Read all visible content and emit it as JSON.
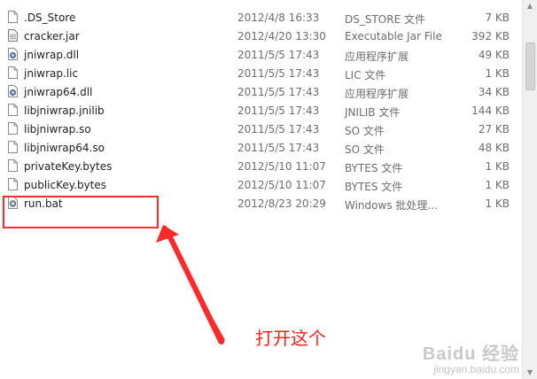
{
  "files": [
    {
      "name": ".DS_Store",
      "date": "2012/4/8 16:33",
      "type": "DS_STORE 文件",
      "size": "7 KB",
      "icon": "file-icon"
    },
    {
      "name": "cracker.jar",
      "date": "2012/4/20 13:30",
      "type": "Executable Jar File",
      "size": "392 KB",
      "icon": "jar-file-icon"
    },
    {
      "name": "jniwrap.dll",
      "date": "2011/5/5 17:43",
      "type": "应用程序扩展",
      "size": "49 KB",
      "icon": "dll-gear-icon"
    },
    {
      "name": "jniwrap.lic",
      "date": "2011/5/5 17:43",
      "type": "LIC 文件",
      "size": "1 KB",
      "icon": "file-icon"
    },
    {
      "name": "jniwrap64.dll",
      "date": "2011/5/5 17:43",
      "type": "应用程序扩展",
      "size": "34 KB",
      "icon": "dll-gear-icon"
    },
    {
      "name": "libjniwrap.jnilib",
      "date": "2011/5/5 17:43",
      "type": "JNILIB 文件",
      "size": "144 KB",
      "icon": "file-icon"
    },
    {
      "name": "libjniwrap.so",
      "date": "2011/5/5 17:43",
      "type": "SO 文件",
      "size": "27 KB",
      "icon": "file-icon"
    },
    {
      "name": "libjniwrap64.so",
      "date": "2011/5/5 17:43",
      "type": "SO 文件",
      "size": "48 KB",
      "icon": "file-icon"
    },
    {
      "name": "privateKey.bytes",
      "date": "2012/5/10 11:07",
      "type": "BYTES 文件",
      "size": "1 KB",
      "icon": "file-icon"
    },
    {
      "name": "publicKey.bytes",
      "date": "2012/5/10 11:07",
      "type": "BYTES 文件",
      "size": "1 KB",
      "icon": "file-icon"
    },
    {
      "name": "run.bat",
      "date": "2012/8/23 20:29",
      "type": "Windows 批处理...",
      "size": "1 KB",
      "icon": "batch-gear-icon"
    }
  ],
  "annotation": {
    "text": "打开这个",
    "color": "#ff2020"
  },
  "watermark": {
    "brand": "Baidu 经验",
    "url": "jingyan.baidu.com"
  },
  "colors": {
    "highlight": "#ff2a2a",
    "text_primary": "#1e1e1e",
    "text_secondary": "#6d6d6d"
  }
}
